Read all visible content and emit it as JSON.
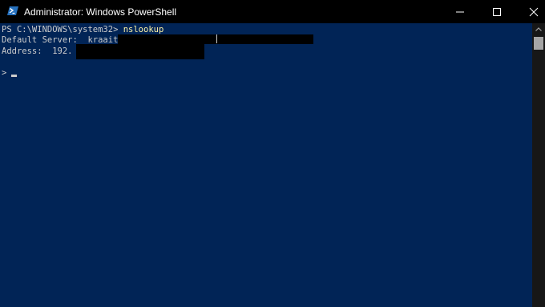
{
  "window": {
    "title": "Administrator: Windows PowerShell",
    "icon": "powershell-icon",
    "buttons": {
      "minimize": "minimize-icon",
      "maximize": "maximize-icon",
      "close": "close-icon"
    }
  },
  "console": {
    "prompt": "PS C:\\WINDOWS\\system32> ",
    "command": "nslookup",
    "server_label": "Default Server:  ",
    "server_value": "kraait",
    "address_label": "Address:  ",
    "address_value": "192.",
    "nslookup_prompt": ">"
  },
  "colors": {
    "background": "#012456",
    "text": "#cccccc",
    "command": "#f9f1a5",
    "titlebar": "#000000"
  }
}
